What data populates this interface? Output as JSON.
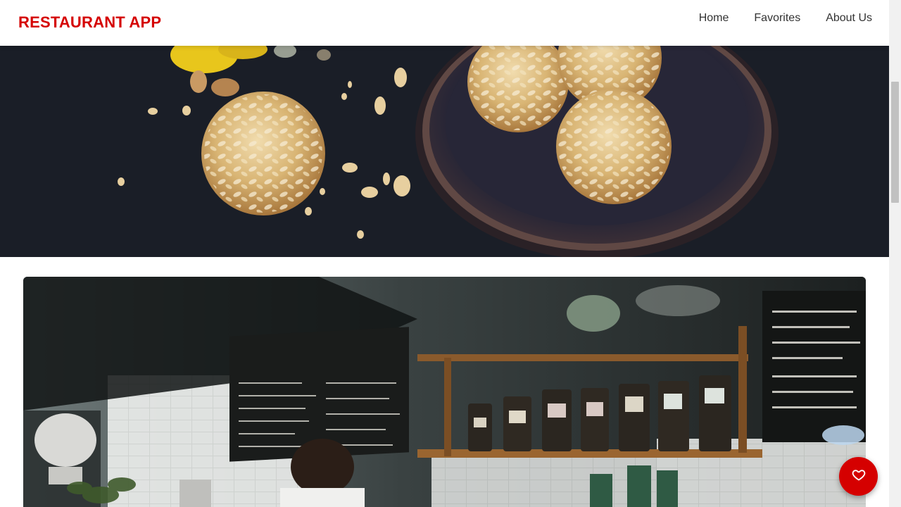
{
  "app_bar": {
    "brand": "RESTAURANT APP",
    "nav": [
      {
        "label": "Home"
      },
      {
        "label": "Favorites"
      },
      {
        "label": "About Us"
      }
    ]
  },
  "hero": {
    "image": "cookies-on-plate-photo"
  },
  "card": {
    "image": "cafe-counter-photo"
  },
  "fab": {
    "icon": "heart-icon"
  },
  "colors": {
    "brand": "#d50000",
    "nav_text": "#333333",
    "background": "#ffffff"
  }
}
